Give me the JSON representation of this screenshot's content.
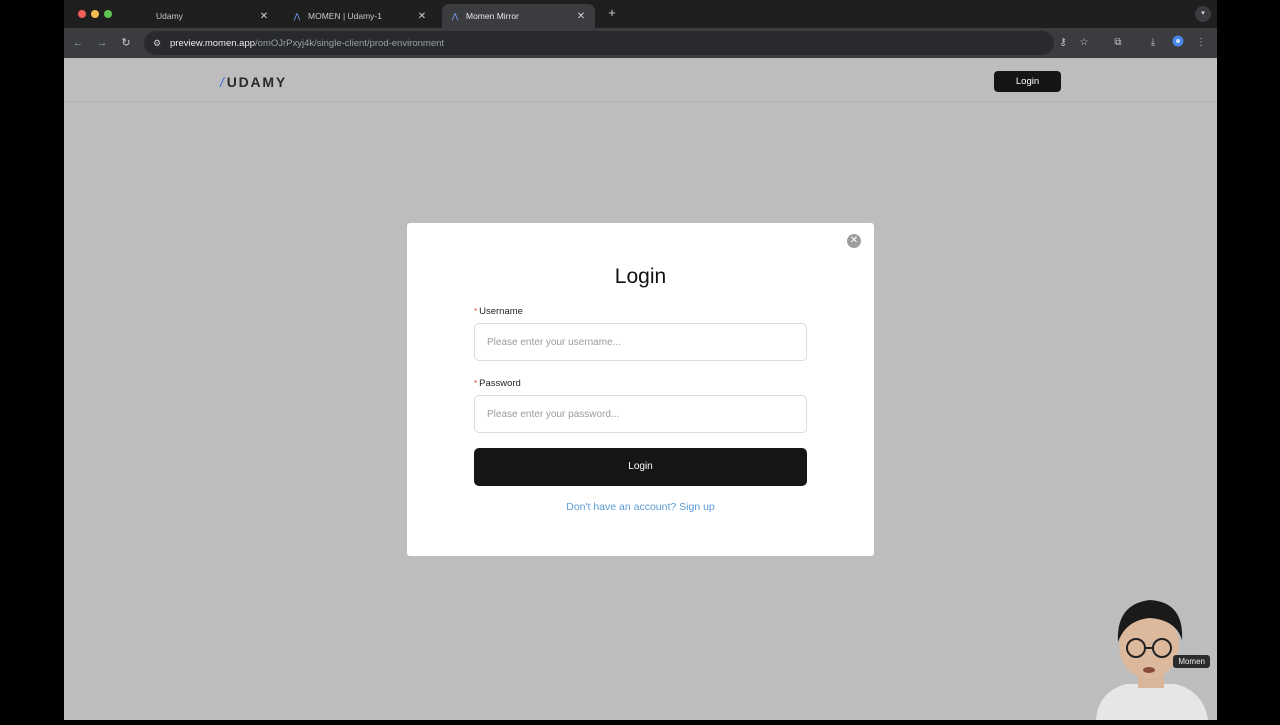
{
  "browser": {
    "tabs": [
      {
        "title": "Udamy",
        "active": false
      },
      {
        "title": "MOMEN | Udamy-1",
        "active": false
      },
      {
        "title": "Momen Mirror",
        "active": true
      }
    ],
    "url_host": "preview.momen.app",
    "url_path": "/omOJrPxyj4k/single-client/prod-environment"
  },
  "site": {
    "logo_slash": "/",
    "logo_text": "UDAMY",
    "login_button": "Login"
  },
  "modal": {
    "title": "Login",
    "required_mark": "*",
    "username_label": "Username",
    "username_placeholder": "Please enter your username...",
    "password_label": "Password",
    "password_placeholder": "Please enter your password...",
    "submit_label": "Login",
    "signup_text": "Don't have an account? Sign up"
  },
  "webcam": {
    "name_tag": "Momen"
  },
  "colors": {
    "accent_link": "#5b9bd5",
    "primary_button": "#161616",
    "page_background": "#bdbdbd"
  }
}
